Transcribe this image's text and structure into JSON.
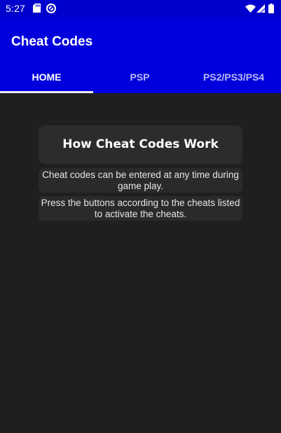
{
  "status_bar": {
    "time": "5:27",
    "left_icons": [
      "sd-card-icon",
      "sync-icon"
    ],
    "right_icons": [
      "wifi-icon",
      "signal-icon",
      "battery-icon"
    ]
  },
  "app_bar": {
    "title": "Cheat Codes"
  },
  "tabs": [
    {
      "label": "HOME",
      "selected": true
    },
    {
      "label": "PSP",
      "selected": false
    },
    {
      "label": "PS2/PS3/PS4",
      "selected": false
    }
  ],
  "content": {
    "heading": "How Cheat Codes Work",
    "paragraphs": [
      [
        "Cheat codes can be entered at any time during",
        "game play."
      ],
      [
        "Press the buttons according to the cheats listed",
        "to activate the cheats."
      ]
    ]
  },
  "colors": {
    "app_bar": "#0000dd",
    "status_bar": "#0000cc",
    "background": "#1f1f1f",
    "card": "#2c2c2c",
    "tab_indicator": "#e9e9f6"
  }
}
